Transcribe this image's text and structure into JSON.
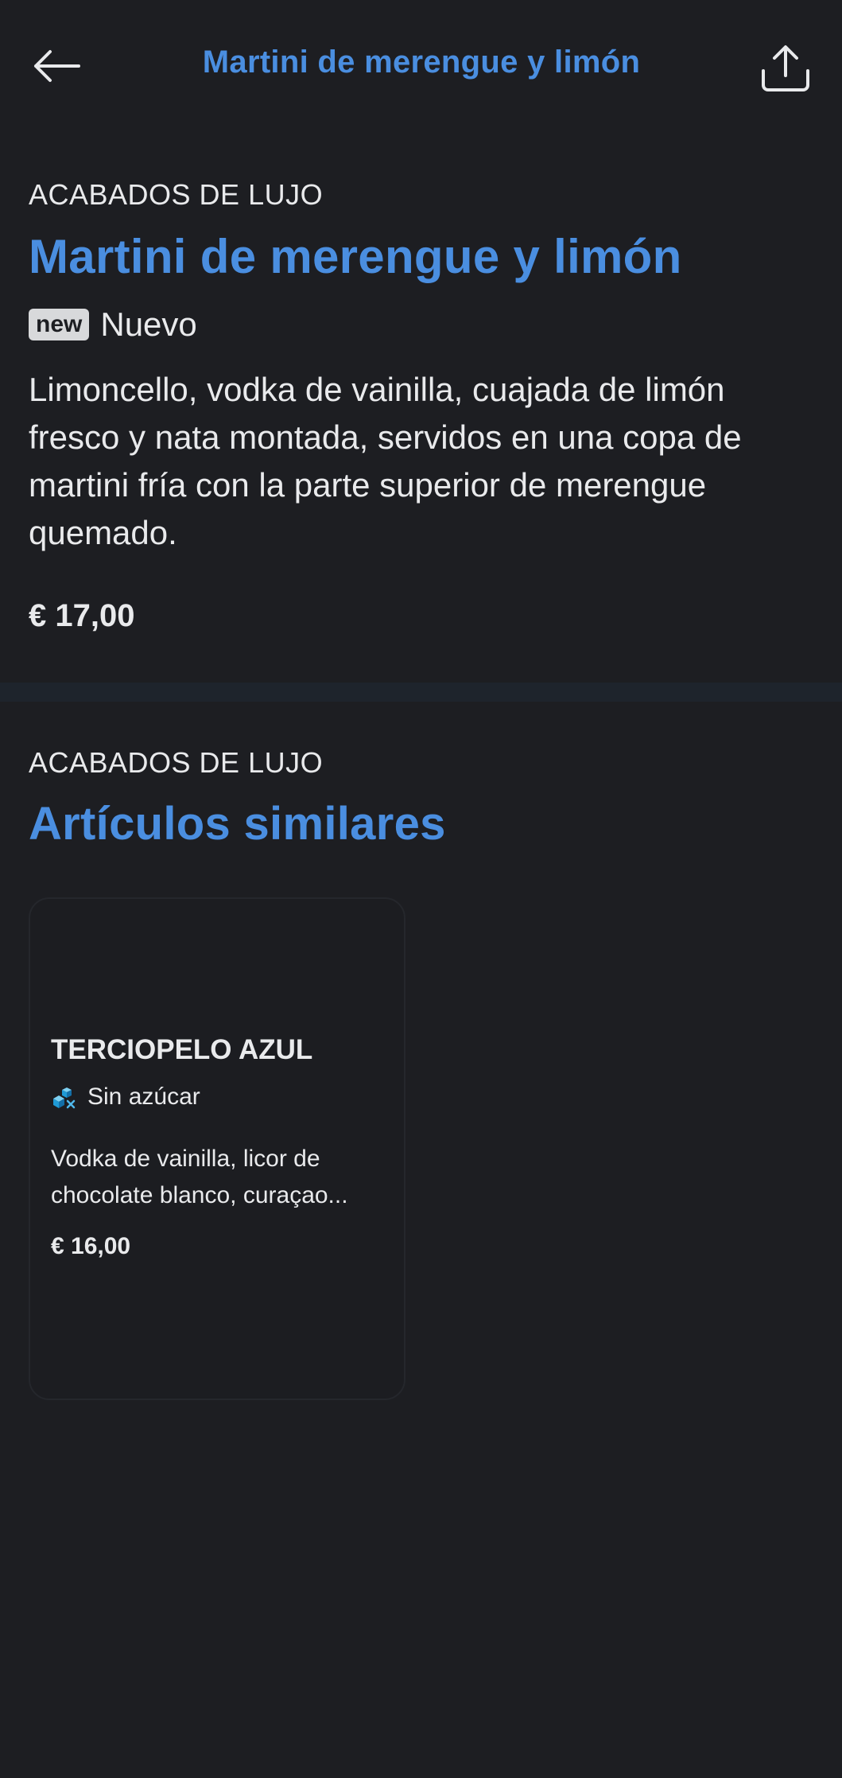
{
  "header": {
    "title": "Martini de merengue y limón",
    "back_icon": "arrow-left-icon",
    "share_icon": "share-icon"
  },
  "product": {
    "category": "ACABADOS DE LUJO",
    "name": "Martini de merengue y limón",
    "badge": "new",
    "badge_label": "Nuevo",
    "description": "Limoncello, vodka de vainilla, cuajada de limón fresco y nata montada, servidos en una copa de martini fría con la parte superior de merengue quemado.",
    "price": "€ 17,00"
  },
  "similar": {
    "category": "ACABADOS DE LUJO",
    "title": "Artículos similares",
    "items": [
      {
        "name": "TERCIOPELO AZUL",
        "tag_icon": "sugar-free-icon",
        "tag": "Sin azúcar",
        "description": "Vodka de vainilla, licor de chocolate blanco, curaçao...",
        "price": "€ 16,00"
      }
    ]
  },
  "colors": {
    "background": "#1d1e22",
    "accent": "#4a8ee0",
    "text": "#e9eaec",
    "divider": "#1e242c"
  }
}
